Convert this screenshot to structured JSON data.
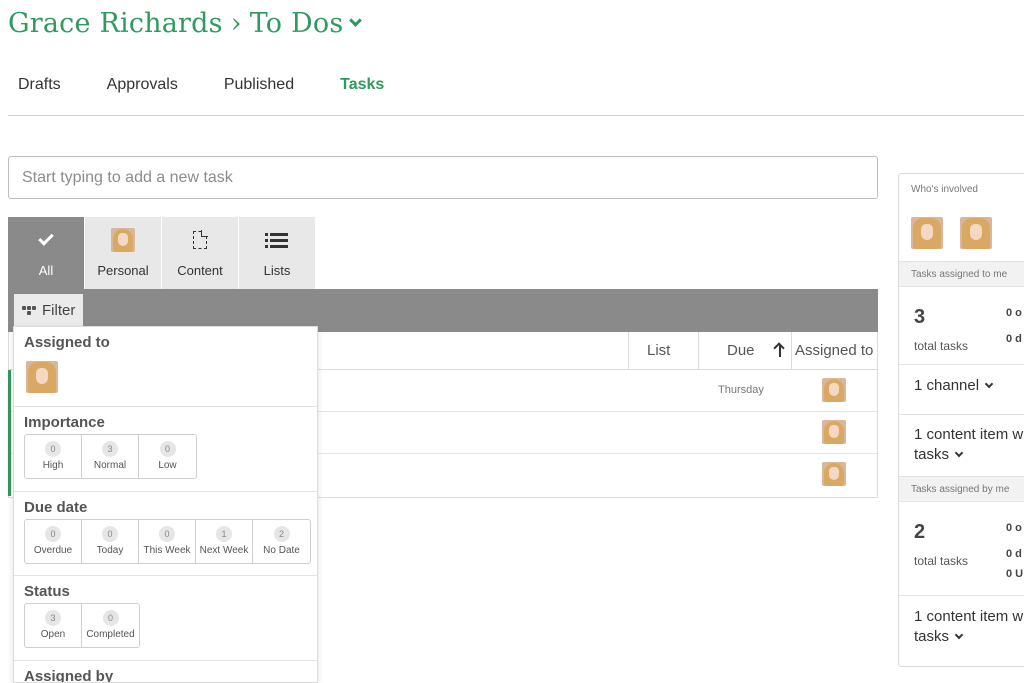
{
  "header": {
    "user": "Grace Richards",
    "separator": "›",
    "page": "To Dos"
  },
  "main_tabs": [
    {
      "label": "Drafts",
      "active": false
    },
    {
      "label": "Approvals",
      "active": false
    },
    {
      "label": "Published",
      "active": false
    },
    {
      "label": "Tasks",
      "active": true
    }
  ],
  "task_input": {
    "placeholder": "Start typing to add a new task",
    "value": ""
  },
  "type_tabs": [
    {
      "label": "All",
      "icon": "check-icon",
      "active": true
    },
    {
      "label": "Personal",
      "icon": "avatar",
      "active": false
    },
    {
      "label": "Content",
      "icon": "document-icon",
      "active": false
    },
    {
      "label": "Lists",
      "icon": "list-icon",
      "active": false
    }
  ],
  "filter": {
    "label": "Filter",
    "icon": "filter-icon"
  },
  "table": {
    "columns": {
      "list": "List",
      "due": "Due",
      "assigned": "Assigned to"
    },
    "sort": "due-ascending",
    "rows": [
      {
        "due": "Thursday"
      },
      {
        "due": ""
      },
      {
        "due": ""
      }
    ]
  },
  "filter_panel": {
    "assigned_to": {
      "title": "Assigned to"
    },
    "importance": {
      "title": "Importance",
      "options": [
        {
          "count": "0",
          "label": "High"
        },
        {
          "count": "3",
          "label": "Normal"
        },
        {
          "count": "0",
          "label": "Low"
        }
      ]
    },
    "due_date": {
      "title": "Due date",
      "options": [
        {
          "count": "0",
          "label": "Overdue"
        },
        {
          "count": "0",
          "label": "Today"
        },
        {
          "count": "0",
          "label": "This Week"
        },
        {
          "count": "1",
          "label": "Next Week"
        },
        {
          "count": "2",
          "label": "No Date"
        }
      ]
    },
    "status": {
      "title": "Status",
      "options": [
        {
          "count": "3",
          "label": "Open"
        },
        {
          "count": "0",
          "label": "Completed"
        }
      ]
    },
    "assigned_by": {
      "title": "Assigned by"
    }
  },
  "side_panel": {
    "whos_involved": "Who's involved",
    "assigned_to_me": {
      "heading": "Tasks assigned to me",
      "total": "3",
      "total_label": "total tasks",
      "partial": [
        "0 o",
        "0 d"
      ],
      "channel_link": "1 channel",
      "content_link_line1": "1 content item w",
      "content_link_line2": "tasks"
    },
    "assigned_by_me": {
      "heading": "Tasks assigned by me",
      "total": "2",
      "total_label": "total tasks",
      "partial": [
        "0 o",
        "0 d",
        "0 U"
      ],
      "content_link_line1": "1 content item w",
      "content_link_line2": "tasks"
    }
  },
  "colors": {
    "accent": "#2e9a5e",
    "bar": "#8a8a8a"
  }
}
